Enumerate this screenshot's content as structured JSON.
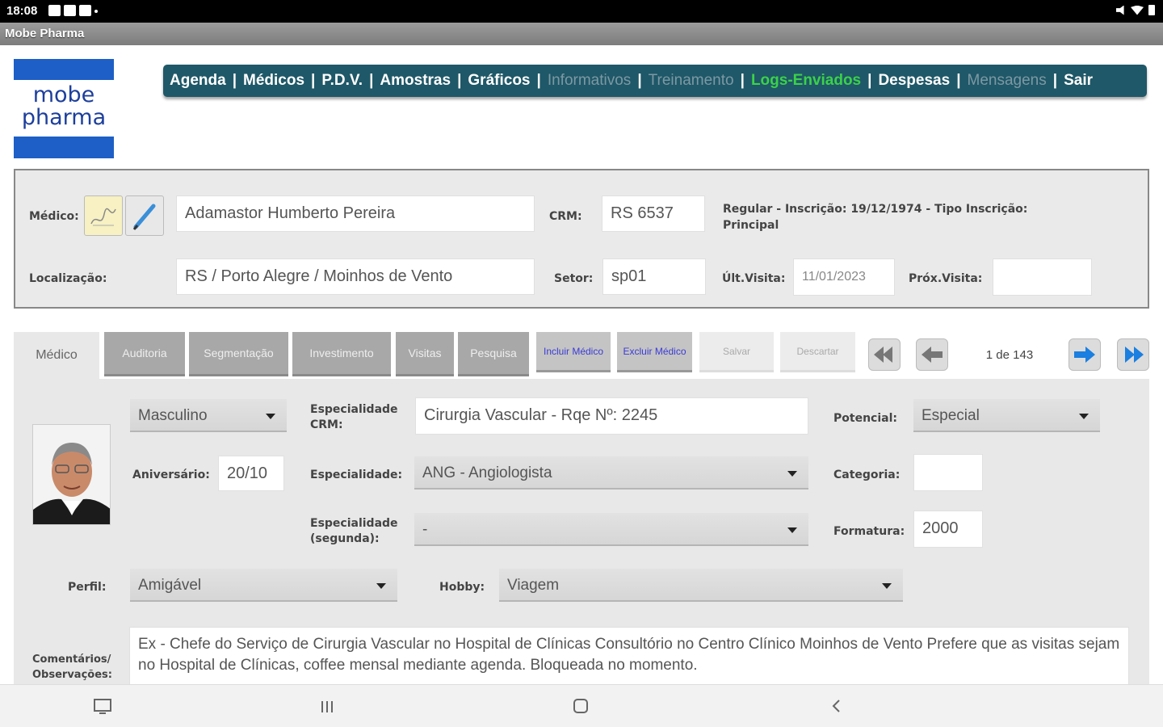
{
  "status_bar": {
    "time": "18:08"
  },
  "window": {
    "title": "Mobe Pharma"
  },
  "logo": {
    "line1": "mobe",
    "line2": "pharma"
  },
  "menu": [
    {
      "label": "Agenda",
      "state": "enabled"
    },
    {
      "label": "Médicos",
      "state": "enabled"
    },
    {
      "label": "P.D.V.",
      "state": "enabled"
    },
    {
      "label": "Amostras",
      "state": "enabled"
    },
    {
      "label": "Gráficos",
      "state": "enabled"
    },
    {
      "label": "Informativos",
      "state": "disabled"
    },
    {
      "label": "Treinamento",
      "state": "disabled"
    },
    {
      "label": "Logs-Enviados",
      "state": "highlight"
    },
    {
      "label": "Despesas",
      "state": "enabled"
    },
    {
      "label": "Mensagens",
      "state": "disabled"
    },
    {
      "label": "Sair",
      "state": "enabled"
    }
  ],
  "doctor_header": {
    "medico_label": "Médico:",
    "medico_name": "Adamastor Humberto Pereira",
    "crm_label": "CRM:",
    "crm_value": "RS 6537",
    "registration_info": "Regular - Inscrição: 19/12/1974 - Tipo Inscrição: Principal",
    "localizacao_label": "Localização:",
    "localizacao_value": "RS / Porto Alegre / Moinhos de Vento",
    "setor_label": "Setor:",
    "setor_value": "sp01",
    "ult_visita_label": "Últ.Visita:",
    "ult_visita_value": "11/01/2023",
    "prox_visita_label": "Próx.Visita:",
    "prox_visita_value": ""
  },
  "tabs": [
    {
      "label": "Médico",
      "active": true
    },
    {
      "label": "Auditoria",
      "active": false
    },
    {
      "label": "Segmentação",
      "active": false
    },
    {
      "label": "Investimento",
      "active": false
    },
    {
      "label": "Visitas",
      "active": false
    },
    {
      "label": "Pesquisa",
      "active": false
    }
  ],
  "actions": {
    "incluir": "Incluir Médico",
    "excluir": "Excluir Médico",
    "salvar": "Salvar",
    "descartar": "Descartar"
  },
  "pagination": {
    "text": "1 de 143"
  },
  "form": {
    "sexo": "Masculino",
    "aniversario_label": "Aniversário:",
    "aniversario_value": "20/10",
    "esp_crm_label": "Especialidade CRM:",
    "esp_crm_value": "Cirurgia Vascular - Rqe Nº: 2245",
    "especialidade_label": "Especialidade:",
    "especialidade_value": "ANG - Angiologista",
    "esp_segunda_label": "Especialidade (segunda):",
    "esp_segunda_value": "-",
    "potencial_label": "Potencial:",
    "potencial_value": "Especial",
    "categoria_label": "Categoria:",
    "categoria_value": "",
    "formatura_label": "Formatura:",
    "formatura_value": "2000",
    "perfil_label": "Perfil:",
    "perfil_value": "Amigável",
    "hobby_label": "Hobby:",
    "hobby_value": "Viagem",
    "comentarios_label": "Comentários/ Observações:",
    "comentarios_value": "Ex - Chefe do Serviço de Cirurgia Vascular no Hospital de Clínicas Consultório no Centro Clínico Moinhos de Vento Prefere que as visitas sejam no Hospital de Clínicas, coffee mensal mediante agenda. Bloqueada no momento."
  },
  "colors": {
    "menu_bg": "#1f5868",
    "menu_highlight": "#3bd14a",
    "logo_blue": "#1d5fc6"
  }
}
